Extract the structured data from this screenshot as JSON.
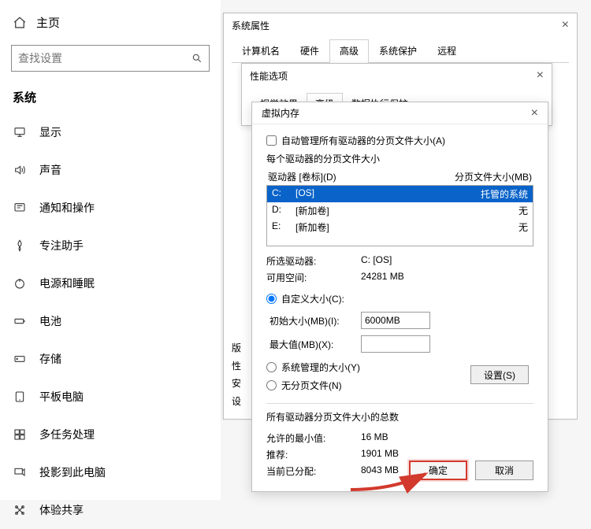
{
  "settings": {
    "home": "主页",
    "search_placeholder": "查找设置",
    "section": "系统",
    "items": [
      {
        "icon": "display-icon",
        "label": "显示"
      },
      {
        "icon": "sound-icon",
        "label": "声音"
      },
      {
        "icon": "notifications-icon",
        "label": "通知和操作"
      },
      {
        "icon": "focus-assist-icon",
        "label": "专注助手"
      },
      {
        "icon": "power-sleep-icon",
        "label": "电源和睡眠"
      },
      {
        "icon": "battery-icon",
        "label": "电池"
      },
      {
        "icon": "storage-icon",
        "label": "存储"
      },
      {
        "icon": "tablet-icon",
        "label": "平板电脑"
      },
      {
        "icon": "multitask-icon",
        "label": "多任务处理"
      },
      {
        "icon": "project-icon",
        "label": "投影到此电脑"
      },
      {
        "icon": "shared-exp-icon",
        "label": "体验共享"
      }
    ]
  },
  "sysprops": {
    "title": "系统属性",
    "tabs": [
      "计算机名",
      "硬件",
      "高级",
      "系统保护",
      "远程"
    ],
    "active_tab": 2,
    "footer_lines": [
      "版",
      "性",
      "安",
      "设"
    ]
  },
  "perf": {
    "title": "性能选项",
    "tabs": [
      "视觉效果",
      "高级",
      "数据执行保护"
    ],
    "active_tab": 1
  },
  "vmem": {
    "title": "虚拟内存",
    "auto_manage": "自动管理所有驱动器的分页文件大小(A)",
    "per_drive_title": "每个驱动器的分页文件大小",
    "col_drive": "驱动器 [卷标](D)",
    "col_size": "分页文件大小(MB)",
    "drives": [
      {
        "letter": "C:",
        "label": "[OS]",
        "size": "托管的系统",
        "selected": true
      },
      {
        "letter": "D:",
        "label": "[新加卷]",
        "size": "无",
        "selected": false
      },
      {
        "letter": "E:",
        "label": "[新加卷]",
        "size": "无",
        "selected": false
      }
    ],
    "selected_drive_label": "所选驱动器:",
    "selected_drive_value": "C:  [OS]",
    "free_space_label": "可用空间:",
    "free_space_value": "24281 MB",
    "custom_size": "自定义大小(C):",
    "initial_label": "初始大小(MB)(I):",
    "initial_value": "6000MB",
    "max_label": "最大值(MB)(X):",
    "max_value": "",
    "system_managed": "系统管理的大小(Y)",
    "no_paging": "无分页文件(N)",
    "set_btn": "设置(S)",
    "totals_title": "所有驱动器分页文件大小的总数",
    "min_label": "允许的最小值:",
    "min_value": "16 MB",
    "rec_label": "推荐:",
    "rec_value": "1901 MB",
    "cur_label": "当前已分配:",
    "cur_value": "8043 MB",
    "ok": "确定",
    "cancel": "取消"
  }
}
